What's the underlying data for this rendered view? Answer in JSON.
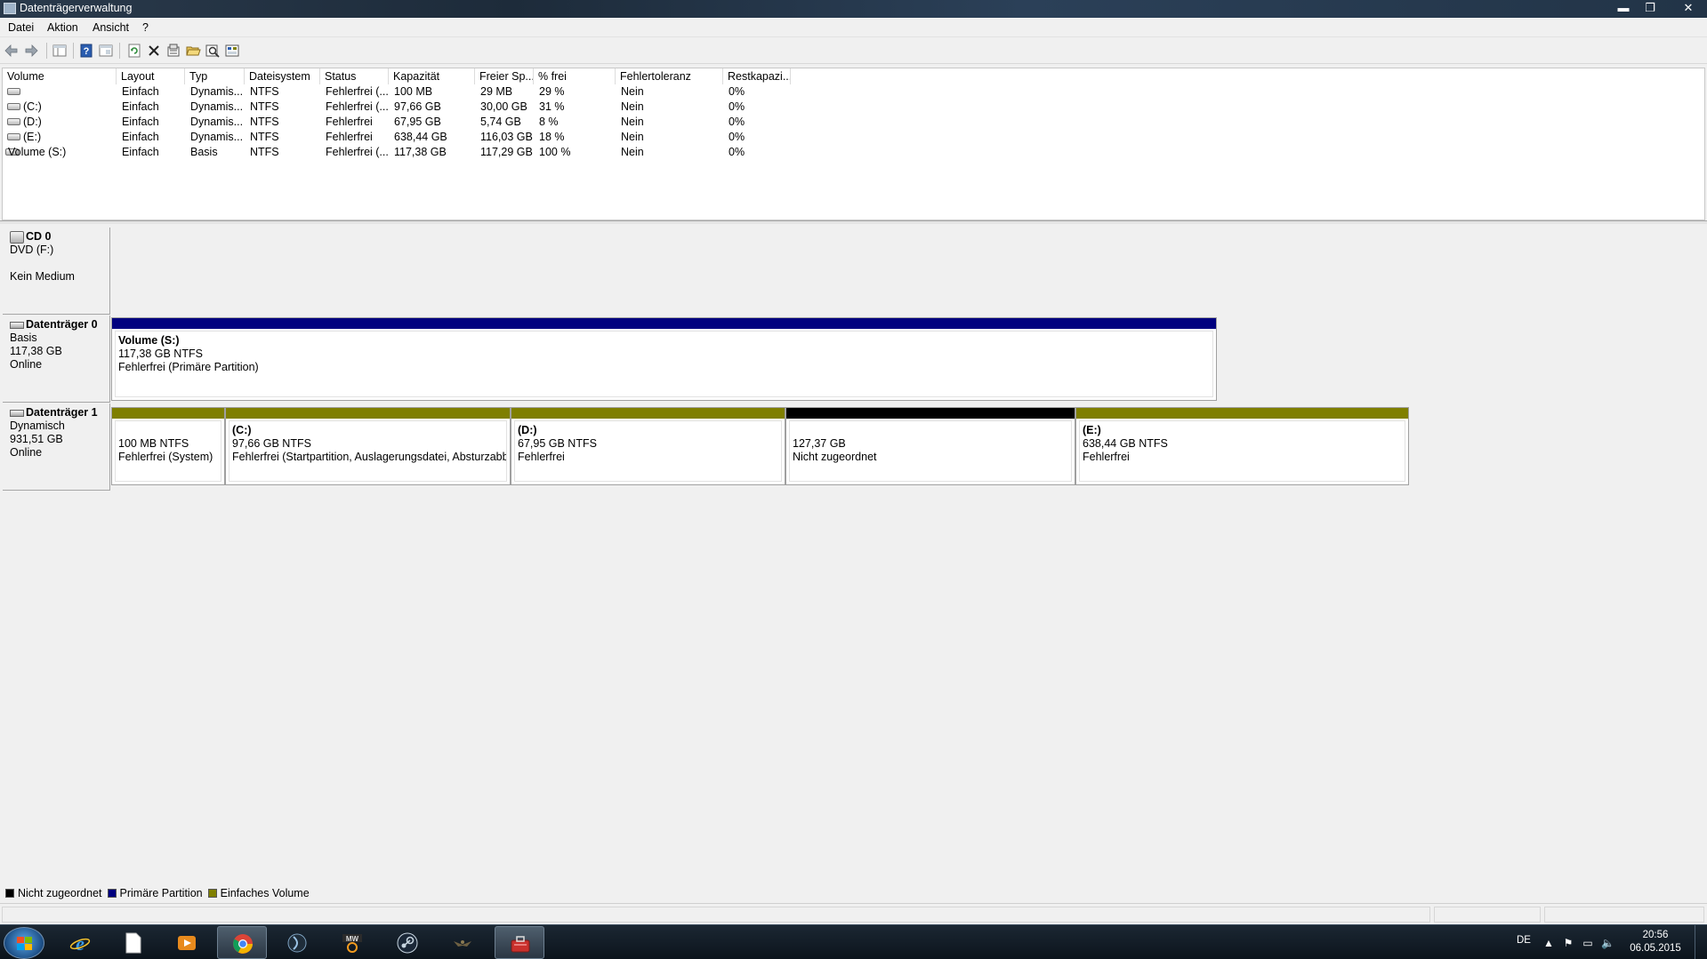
{
  "window": {
    "title": "Datenträgerverwaltung",
    "minimize_glyph": "▬",
    "maximize_glyph": "❐",
    "close_glyph": "✕"
  },
  "menu": [
    "Datei",
    "Aktion",
    "Ansicht",
    "?"
  ],
  "toolbar_icons": [
    "back-icon",
    "forward-icon",
    "show-hide-tree-icon",
    "help-icon",
    "console-view-icon",
    "refresh-icon",
    "delete-icon",
    "properties-icon",
    "open-icon",
    "explore-icon",
    "rescan-disks-icon"
  ],
  "volume_table": {
    "columns": [
      "Volume",
      "Layout",
      "Typ",
      "Dateisystem",
      "Status",
      "Kapazität",
      "Freier Sp...",
      "% frei",
      "Fehlertoleranz",
      "Restkapazi..."
    ],
    "rows": [
      [
        "",
        "Einfach",
        "Dynamis...",
        "NTFS",
        "Fehlerfrei (...",
        "100 MB",
        "29 MB",
        "29 %",
        "Nein",
        "0%"
      ],
      [
        "(C:)",
        "Einfach",
        "Dynamis...",
        "NTFS",
        "Fehlerfrei (...",
        "97,66 GB",
        "30,00 GB",
        "31 %",
        "Nein",
        "0%"
      ],
      [
        "(D:)",
        "Einfach",
        "Dynamis...",
        "NTFS",
        "Fehlerfrei",
        "67,95 GB",
        "5,74 GB",
        "8 %",
        "Nein",
        "0%"
      ],
      [
        "(E:)",
        "Einfach",
        "Dynamis...",
        "NTFS",
        "Fehlerfrei",
        "638,44 GB",
        "116,03 GB",
        "18 %",
        "Nein",
        "0%"
      ],
      [
        "Volume (S:)",
        "Einfach",
        "Basis",
        "NTFS",
        "Fehlerfrei (...",
        "117,38 GB",
        "117,29 GB",
        "100 %",
        "Nein",
        "0%"
      ]
    ]
  },
  "disks": [
    {
      "name": "CD 0",
      "icon": "cd-drive-icon",
      "lines": [
        "DVD (F:)",
        "",
        "Kein Medium"
      ],
      "segments": []
    },
    {
      "name": "Datenträger 0",
      "icon": "hard-disk-icon",
      "lines": [
        "Basis",
        "117,38 GB",
        "Online"
      ],
      "segments": [
        {
          "label": "Volume  (S:)",
          "size": "117,38 GB NTFS",
          "status": "Fehlerfrei (Primäre Partition)",
          "bar_color": "#00007f",
          "width_fraction": 0.694
        }
      ]
    },
    {
      "name": "Datenträger 1",
      "icon": "hard-disk-icon",
      "lines": [
        "Dynamisch",
        "931,51 GB",
        "Online"
      ],
      "segments": [
        {
          "label": "",
          "size": "100 MB NTFS",
          "status": "Fehlerfrei (System)",
          "bar_color": "#7f7f00",
          "width_fraction": 0.0715
        },
        {
          "label": "(C:)",
          "size": "97,66 GB NTFS",
          "status": "Fehlerfrei (Startpartition, Auslagerungsdatei, Absturzabbild)",
          "bar_color": "#7f7f00",
          "width_fraction": 0.179
        },
        {
          "label": "(D:)",
          "size": "67,95 GB NTFS",
          "status": "Fehlerfrei",
          "bar_color": "#7f7f00",
          "width_fraction": 0.1725
        },
        {
          "label": "",
          "size": "127,37 GB",
          "status": "Nicht zugeordnet",
          "bar_color": "#000000",
          "width_fraction": 0.182
        },
        {
          "label": "(E:)",
          "size": "638,44 GB NTFS",
          "status": "Fehlerfrei",
          "bar_color": "#7f7f00",
          "width_fraction": 0.2095
        }
      ]
    }
  ],
  "legend": [
    {
      "label": "Nicht zugeordnet",
      "color": "#000000"
    },
    {
      "label": "Primäre Partition",
      "color": "#00007f"
    },
    {
      "label": "Einfaches Volume",
      "color": "#7f7f00"
    }
  ],
  "taskbar": {
    "apps": [
      "internet-explorer-icon",
      "document-icon",
      "media-player-icon",
      "chrome-icon",
      "game-launcher-icon",
      "mwo-icon",
      "steam-icon",
      "eagle-icon",
      "computer-management-icon"
    ],
    "tray_language": "DE",
    "tray_icons": [
      "show-hidden-icons-icon",
      "action-center-flag-icon",
      "network-icon",
      "volume-icon"
    ],
    "time": "20:56",
    "date": "06.05.2015"
  }
}
